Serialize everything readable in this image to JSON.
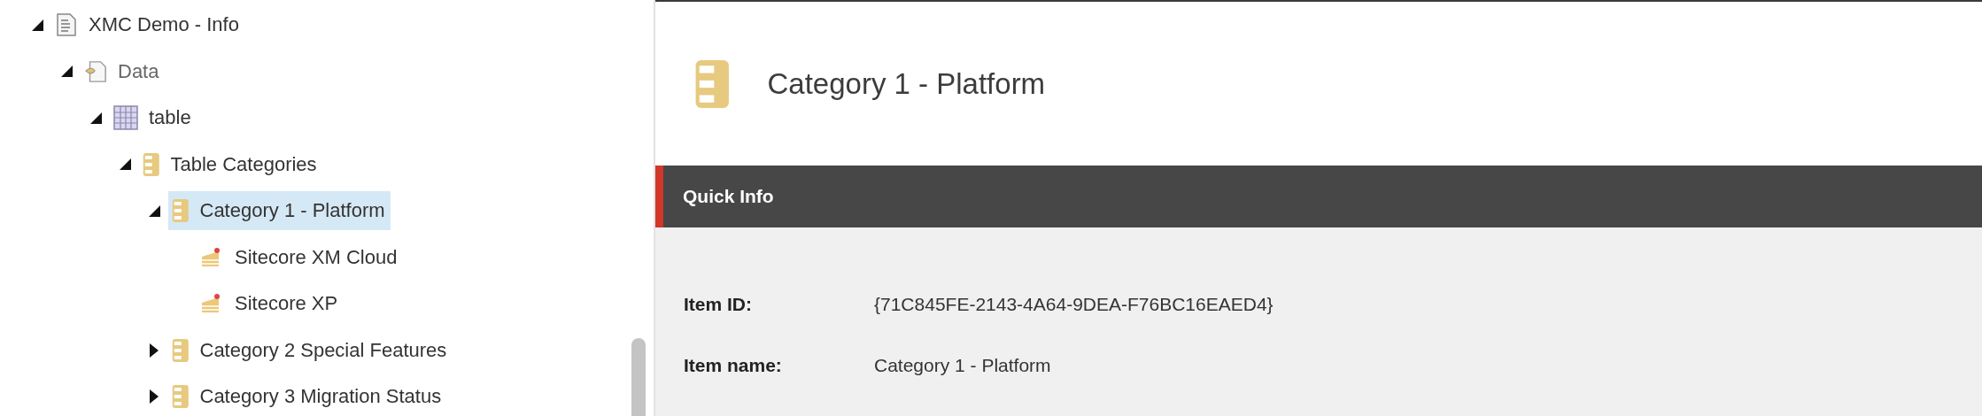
{
  "tree": [
    {
      "label": "XMC Demo - Info",
      "kind": "document",
      "expanded": true,
      "selected": false,
      "dimmed": false,
      "children": [
        {
          "label": "Data",
          "kind": "data",
          "expanded": true,
          "selected": false,
          "dimmed": true,
          "children": [
            {
              "label": "table",
              "kind": "table",
              "expanded": true,
              "selected": false,
              "dimmed": false,
              "children": [
                {
                  "label": "Table Categories",
                  "kind": "stack",
                  "expanded": true,
                  "selected": false,
                  "dimmed": false,
                  "children": [
                    {
                      "label": "Category 1 - Platform",
                      "kind": "stack",
                      "expanded": true,
                      "selected": true,
                      "dimmed": false,
                      "children": [
                        {
                          "label": "Sitecore XM Cloud",
                          "kind": "cake",
                          "selected": false,
                          "dimmed": false
                        },
                        {
                          "label": "Sitecore XP",
                          "kind": "cake",
                          "selected": false,
                          "dimmed": false
                        }
                      ]
                    },
                    {
                      "label": "Category 2 Special Features",
                      "kind": "stack",
                      "expanded": false,
                      "selected": false,
                      "dimmed": false
                    },
                    {
                      "label": "Category 3 Migration Status",
                      "kind": "stack",
                      "expanded": false,
                      "selected": false,
                      "dimmed": false
                    }
                  ]
                }
              ]
            }
          ]
        }
      ]
    }
  ],
  "header": {
    "title": "Category 1 - Platform",
    "kind": "stack"
  },
  "quick_info": {
    "title": "Quick Info",
    "fields": [
      {
        "label": "Item ID:",
        "value": "{71C845FE-2143-4A64-9DEA-F76BC16EAED4}"
      },
      {
        "label": "Item name:",
        "value": "Category 1 - Platform"
      }
    ]
  }
}
